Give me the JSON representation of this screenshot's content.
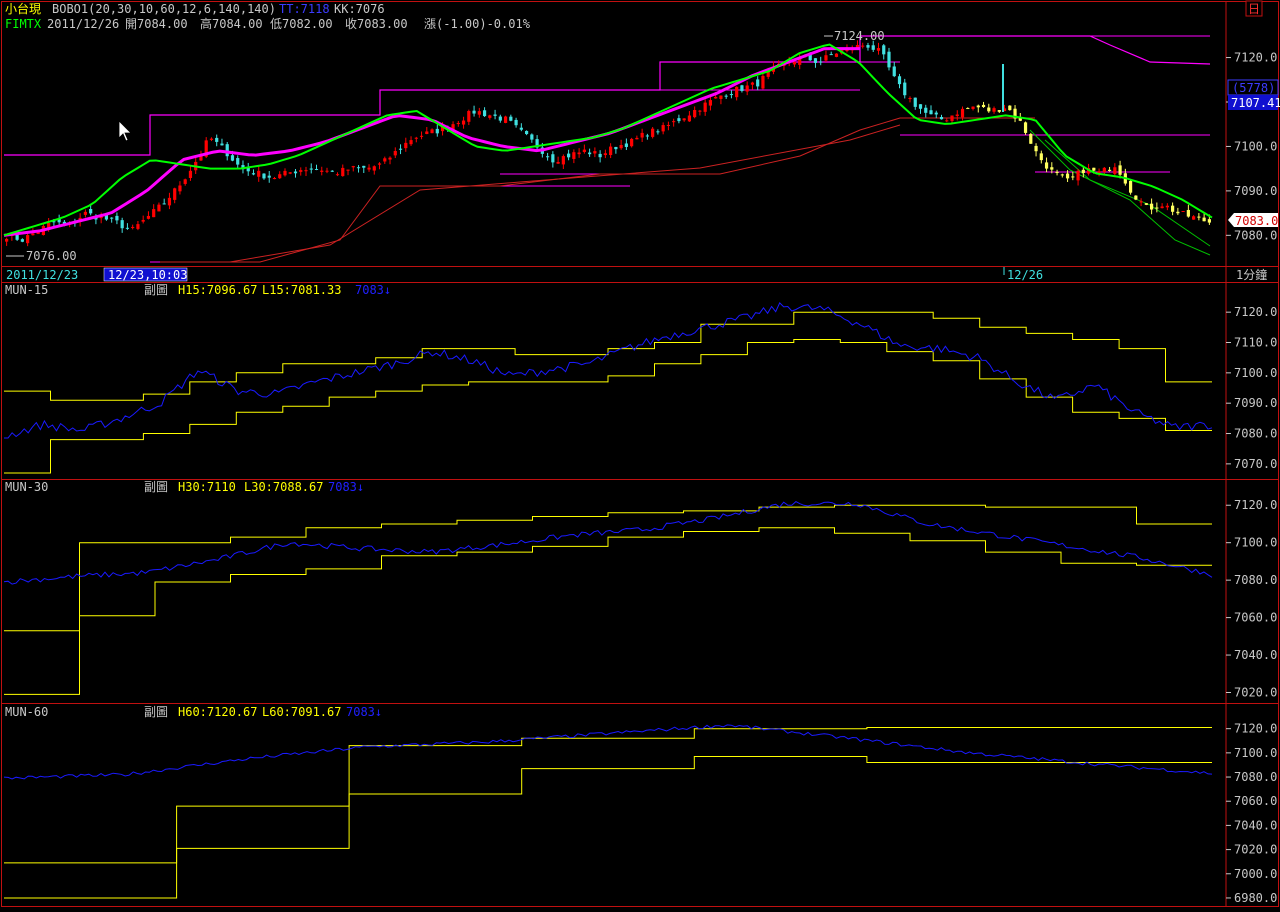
{
  "header": {
    "symbol": "小台現",
    "indicator": "BOBO1(20,30,10,60,12,6,140,140)",
    "tt": "TT:7118",
    "kk": "KK:7076",
    "code": "FIMTX",
    "date": "2011/12/26",
    "open": "開7084.00",
    "high": "高7084.00",
    "low": "低7082.00",
    "close": "收7083.00",
    "change": "漲(-1.00)-0.01%",
    "corner_icon": "日"
  },
  "price_panel": {
    "high_label": "7124.00",
    "low_label": "7076.00",
    "volume_badge": "(5778)",
    "value_badge": "7107.41",
    "last_price_tag": "7083.0",
    "y_ticks": [
      "7120.0",
      "7110.0",
      "7100.0",
      "7090.0",
      "7080.0"
    ],
    "colors": {
      "up": "#ff0000",
      "down": "#40e0e0",
      "ma_magenta": "#ff00ff",
      "ma_green": "#00ff00",
      "band": "#ff00ff",
      "channel": "#cc2222"
    }
  },
  "time_bar": {
    "start_date": "2011/12/23",
    "cursor_time": "12/23,10:03",
    "day_marker": "12/26",
    "interval": "1分鐘"
  },
  "subpanels": [
    {
      "name": "MUN-15",
      "sub": "副圖",
      "h": "H15:7096.67",
      "l": "L15:7081.33",
      "v": "7083↓",
      "y_ticks": [
        "7120.0",
        "7110.0",
        "7100.0",
        "7090.0",
        "7080.0",
        "7070.0"
      ]
    },
    {
      "name": "MUN-30",
      "sub": "副圖",
      "h": "H30:7110",
      "l": "L30:7088.67",
      "v": "7083↓",
      "y_ticks": [
        "7120.0",
        "7100.0",
        "7080.0",
        "7060.0",
        "7040.0",
        "7020.0"
      ]
    },
    {
      "name": "MUN-60",
      "sub": "副圖",
      "h": "H60:7120.67",
      "l": "L60:7091.67",
      "v": "7083↓",
      "y_ticks": [
        "7120.0",
        "7100.0",
        "7080.0",
        "7060.0",
        "7040.0",
        "7020.0",
        "7000.0",
        "6980.0"
      ]
    }
  ],
  "chart_data": [
    {
      "type": "candlestick",
      "title": "小台現 1分鐘",
      "ylim": [
        7074,
        7128
      ],
      "x_range": [
        "2011/12/23",
        "2011/12/26"
      ],
      "close_path": [
        7080,
        7079,
        7081,
        7083,
        7082,
        7085,
        7084,
        7083,
        7081,
        7084,
        7087,
        7091,
        7096,
        7102,
        7099,
        7095,
        7094,
        7093,
        7094,
        7095,
        7095,
        7094,
        7095,
        7095,
        7096,
        7099,
        7102,
        7103,
        7104,
        7106,
        7108,
        7107,
        7106,
        7103,
        7100,
        7097,
        7098,
        7099,
        7098,
        7100,
        7101,
        7103,
        7104,
        7106,
        7108,
        7110,
        7112,
        7113,
        7114,
        7117,
        7119,
        7120,
        7119,
        7121,
        7122,
        7123,
        7121,
        7114,
        7110,
        7107,
        7106,
        7108,
        7109,
        7108,
        7109,
        7105,
        7098,
        7094,
        7092,
        7095,
        7094,
        7096,
        7090,
        7086,
        7087,
        7085,
        7084,
        7083
      ],
      "moving_average_magenta": [
        7080,
        7081,
        7083,
        7085,
        7090,
        7097,
        7099,
        7098,
        7099,
        7101,
        7104,
        7107,
        7106,
        7102,
        7100,
        7099,
        7101,
        7103,
        7106,
        7109,
        7112,
        7116,
        7119,
        7122,
        7122
      ],
      "moving_average_green": [
        7080,
        7082,
        7084,
        7087,
        7093,
        7097,
        7096,
        7095,
        7095,
        7096,
        7098,
        7101,
        7104,
        7107,
        7108,
        7104,
        7100,
        7099,
        7100,
        7101,
        7102,
        7104,
        7107,
        7110,
        7113,
        7115,
        7117,
        7121,
        7123,
        7119,
        7112,
        7106,
        7105,
        7106,
        7107,
        7106,
        7098,
        7094,
        7093,
        7091,
        7088,
        7084
      ]
    },
    {
      "type": "line",
      "title": "MUN-15",
      "ylim": [
        7066,
        7125
      ],
      "series": [
        {
          "name": "H15",
          "color": "#ffff00",
          "values": [
            7094,
            7091,
            7091,
            7093,
            7097,
            7100,
            7103,
            7103,
            7105,
            7108,
            7108,
            7106,
            7106,
            7108,
            7110,
            7116,
            7116,
            7120,
            7120,
            7120,
            7118,
            7115,
            7113,
            7111,
            7108,
            7097
          ]
        },
        {
          "name": "L15",
          "color": "#ffff00",
          "values": [
            7067,
            7078,
            7078,
            7080,
            7083,
            7087,
            7089,
            7092,
            7094,
            7096,
            7097,
            7097,
            7097,
            7099,
            7103,
            7106,
            7110,
            7111,
            7110,
            7107,
            7104,
            7098,
            7092,
            7087,
            7085,
            7081
          ]
        },
        {
          "name": "MUN",
          "color": "#1a1aff",
          "values": [
            7079,
            7083,
            7081,
            7085,
            7090,
            7101,
            7094,
            7093,
            7097,
            7100,
            7103,
            7107,
            7104,
            7099,
            7101,
            7103,
            7108,
            7112,
            7115,
            7118,
            7122,
            7121,
            7116,
            7109,
            7108,
            7105,
            7097,
            7091,
            7096,
            7087,
            7082,
            7083
          ]
        }
      ]
    },
    {
      "type": "line",
      "title": "MUN-30",
      "ylim": [
        7016,
        7126
      ],
      "series": [
        {
          "name": "H30",
          "color": "#ffff00",
          "values": [
            7053,
            7100,
            7100,
            7103,
            7108,
            7110,
            7112,
            7114,
            7116,
            7117,
            7119,
            7120,
            7120,
            7119,
            7119,
            7110
          ]
        },
        {
          "name": "L30",
          "color": "#ffff00",
          "values": [
            7019,
            7061,
            7079,
            7083,
            7086,
            7093,
            7095,
            7098,
            7103,
            7106,
            7108,
            7105,
            7101,
            7095,
            7089,
            7088
          ]
        },
        {
          "name": "MUN",
          "color": "#1a1aff",
          "values": [
            7079,
            7082,
            7084,
            7091,
            7100,
            7097,
            7095,
            7099,
            7104,
            7107,
            7113,
            7121,
            7121,
            7110,
            7104,
            7098,
            7092,
            7083
          ]
        }
      ]
    },
    {
      "type": "line",
      "title": "MUN-60",
      "ylim": [
        6975,
        7128
      ],
      "series": [
        {
          "name": "H60",
          "color": "#ffff00",
          "values": [
            7009,
            7056,
            7106,
            7112,
            7120,
            7121,
            7121
          ]
        },
        {
          "name": "L60",
          "color": "#ffff00",
          "values": [
            6980,
            7021,
            7066,
            7087,
            7097,
            7092,
            7092
          ]
        },
        {
          "name": "MUN",
          "color": "#1a1aff",
          "values": [
            7079,
            7082,
            7095,
            7105,
            7109,
            7116,
            7123,
            7112,
            7100,
            7091,
            7083
          ]
        }
      ]
    }
  ]
}
